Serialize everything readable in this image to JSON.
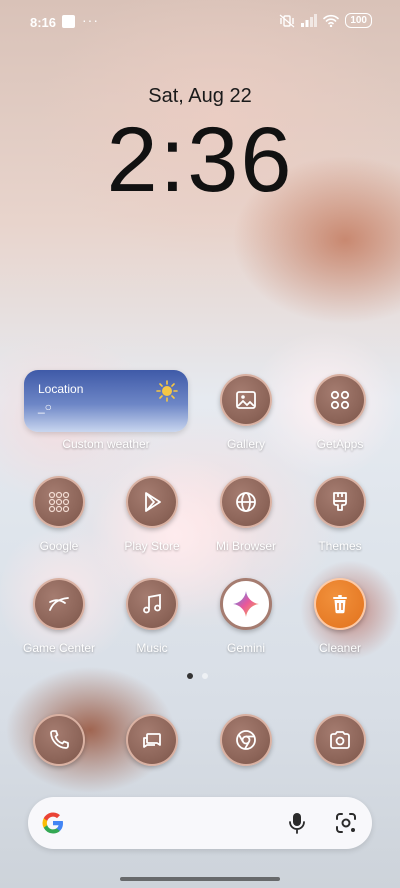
{
  "status_bar": {
    "time": "8:16",
    "dots": "···",
    "battery": "100"
  },
  "clock": {
    "date": "Sat, Aug 22",
    "time": "2:36"
  },
  "weather": {
    "location": "Location",
    "temp": "_○",
    "label": "Custom weather"
  },
  "apps": {
    "gallery": "Gallery",
    "getapps": "GetApps",
    "google": "Google",
    "play_store": "Play Store",
    "mi_browser": "Mi Browser",
    "themes": "Themes",
    "game_center": "Game Center",
    "music": "Music",
    "gemini": "Gemini",
    "cleaner": "Cleaner"
  },
  "dock": [
    "phone-icon",
    "messages-icon",
    "chrome-icon",
    "camera-icon"
  ],
  "colors": {
    "icon_bg": "#8e665a",
    "icon_border": "#e6beaf",
    "cleaner": "#e2721d",
    "widget": "#3f5aa8"
  }
}
